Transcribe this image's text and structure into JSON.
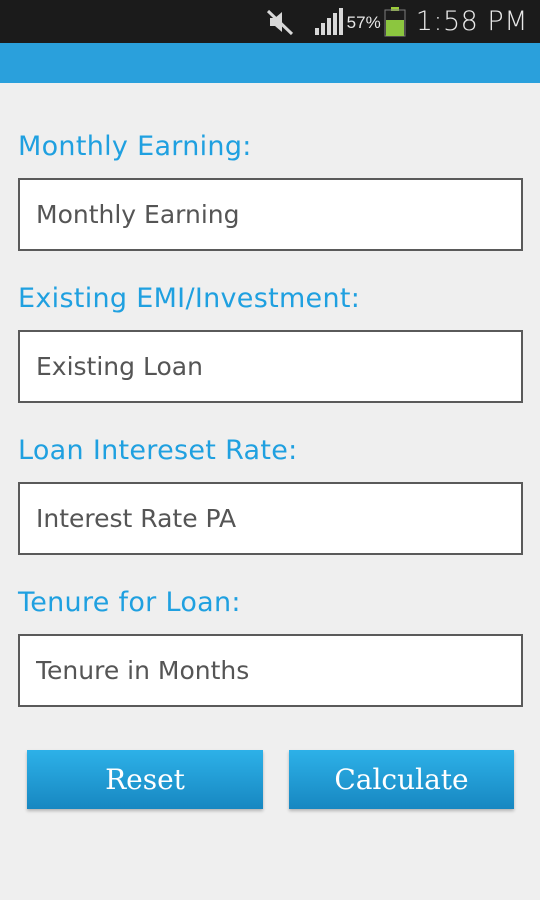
{
  "status_bar": {
    "battery_percent": "57%",
    "time": "1:58 PM",
    "icons": [
      "mute-icon",
      "signal-icon",
      "battery-icon"
    ]
  },
  "colors": {
    "action_bar": "#2aa0dc",
    "label": "#1fa0e0",
    "button": "#1f9ad4"
  },
  "form": {
    "fields": [
      {
        "label": "Monthly Earning:",
        "placeholder": "Monthly Earning",
        "value": ""
      },
      {
        "label": "Existing EMI/Investment:",
        "placeholder": "Existing Loan",
        "value": ""
      },
      {
        "label": "Loan Intereset Rate:",
        "placeholder": "Interest Rate PA",
        "value": ""
      },
      {
        "label": "Tenure for Loan:",
        "placeholder": "Tenure in Months",
        "value": ""
      }
    ],
    "reset_label": "Reset",
    "calculate_label": "Calculate"
  }
}
